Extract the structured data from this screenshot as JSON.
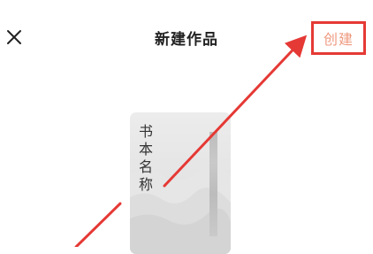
{
  "header": {
    "title": "新建作品",
    "create_label": "创建"
  },
  "book": {
    "title_chars": [
      "书",
      "本",
      "名",
      "称"
    ]
  },
  "icons": {
    "close": "close-icon"
  },
  "colors": {
    "highlight_border": "#e53935",
    "create_text": "#ef9a80",
    "arrow": "#e53935"
  }
}
